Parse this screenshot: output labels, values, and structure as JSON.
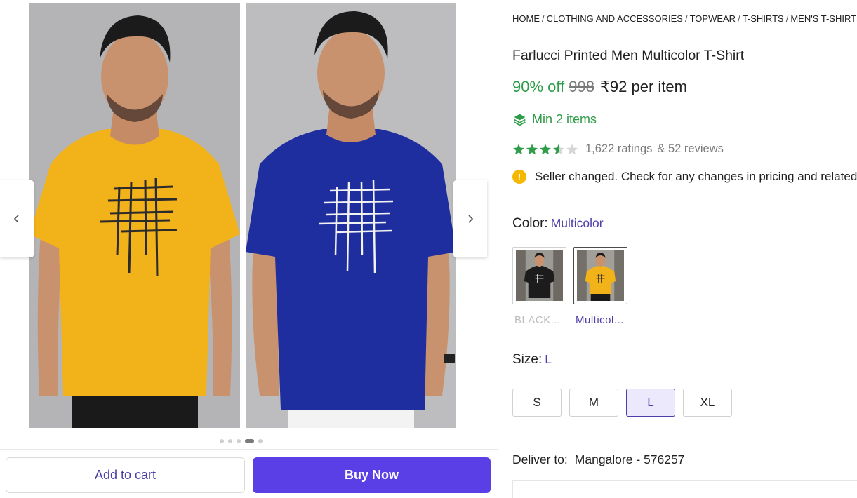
{
  "gallery": {
    "images": [
      {
        "alt": "yellow-tshirt-photo",
        "shirt_color": "#f2b21a",
        "print_color": "#2b2b2b"
      },
      {
        "alt": "blue-tshirt-photo",
        "shirt_color": "#1f2e9f",
        "print_color": "#f2f2f2"
      }
    ],
    "dots_total": 5,
    "dots_active": 4,
    "prev_icon": "chevron-left-icon",
    "next_icon": "chevron-right-icon"
  },
  "actions": {
    "add_to_cart": "Add to cart",
    "buy_now": "Buy Now"
  },
  "breadcrumb": [
    "HOME",
    "CLOTHING AND ACCESSORIES",
    "TOPWEAR",
    "T-SHIRTS",
    "MEN'S T-SHIRTS"
  ],
  "product": {
    "title": "Farlucci Printed Men Multicolor T-Shirt",
    "discount": "90% off",
    "mrp": "998",
    "price": "₹92 per item",
    "min_items": "Min 2 items",
    "rating_value": 3.5,
    "ratings": "1,622 ratings",
    "reviews": "& 52 reviews",
    "notice": "Seller changed. Check for any changes in pricing and related"
  },
  "color": {
    "label": "Color:",
    "selected": "Multicolor",
    "options": [
      {
        "label": "BLACK...",
        "shirt_color": "#1c1c1c"
      },
      {
        "label": "Multicol...",
        "shirt_color": "#f2b21a"
      }
    ]
  },
  "size": {
    "label": "Size:",
    "selected": "L",
    "options": [
      "S",
      "M",
      "L",
      "XL"
    ]
  },
  "delivery": {
    "label": "Deliver to:",
    "location": "Mangalore - 576257"
  },
  "colors": {
    "accent": "#5a3ee6",
    "green": "#2e9c48",
    "link": "#4b3fa8"
  }
}
